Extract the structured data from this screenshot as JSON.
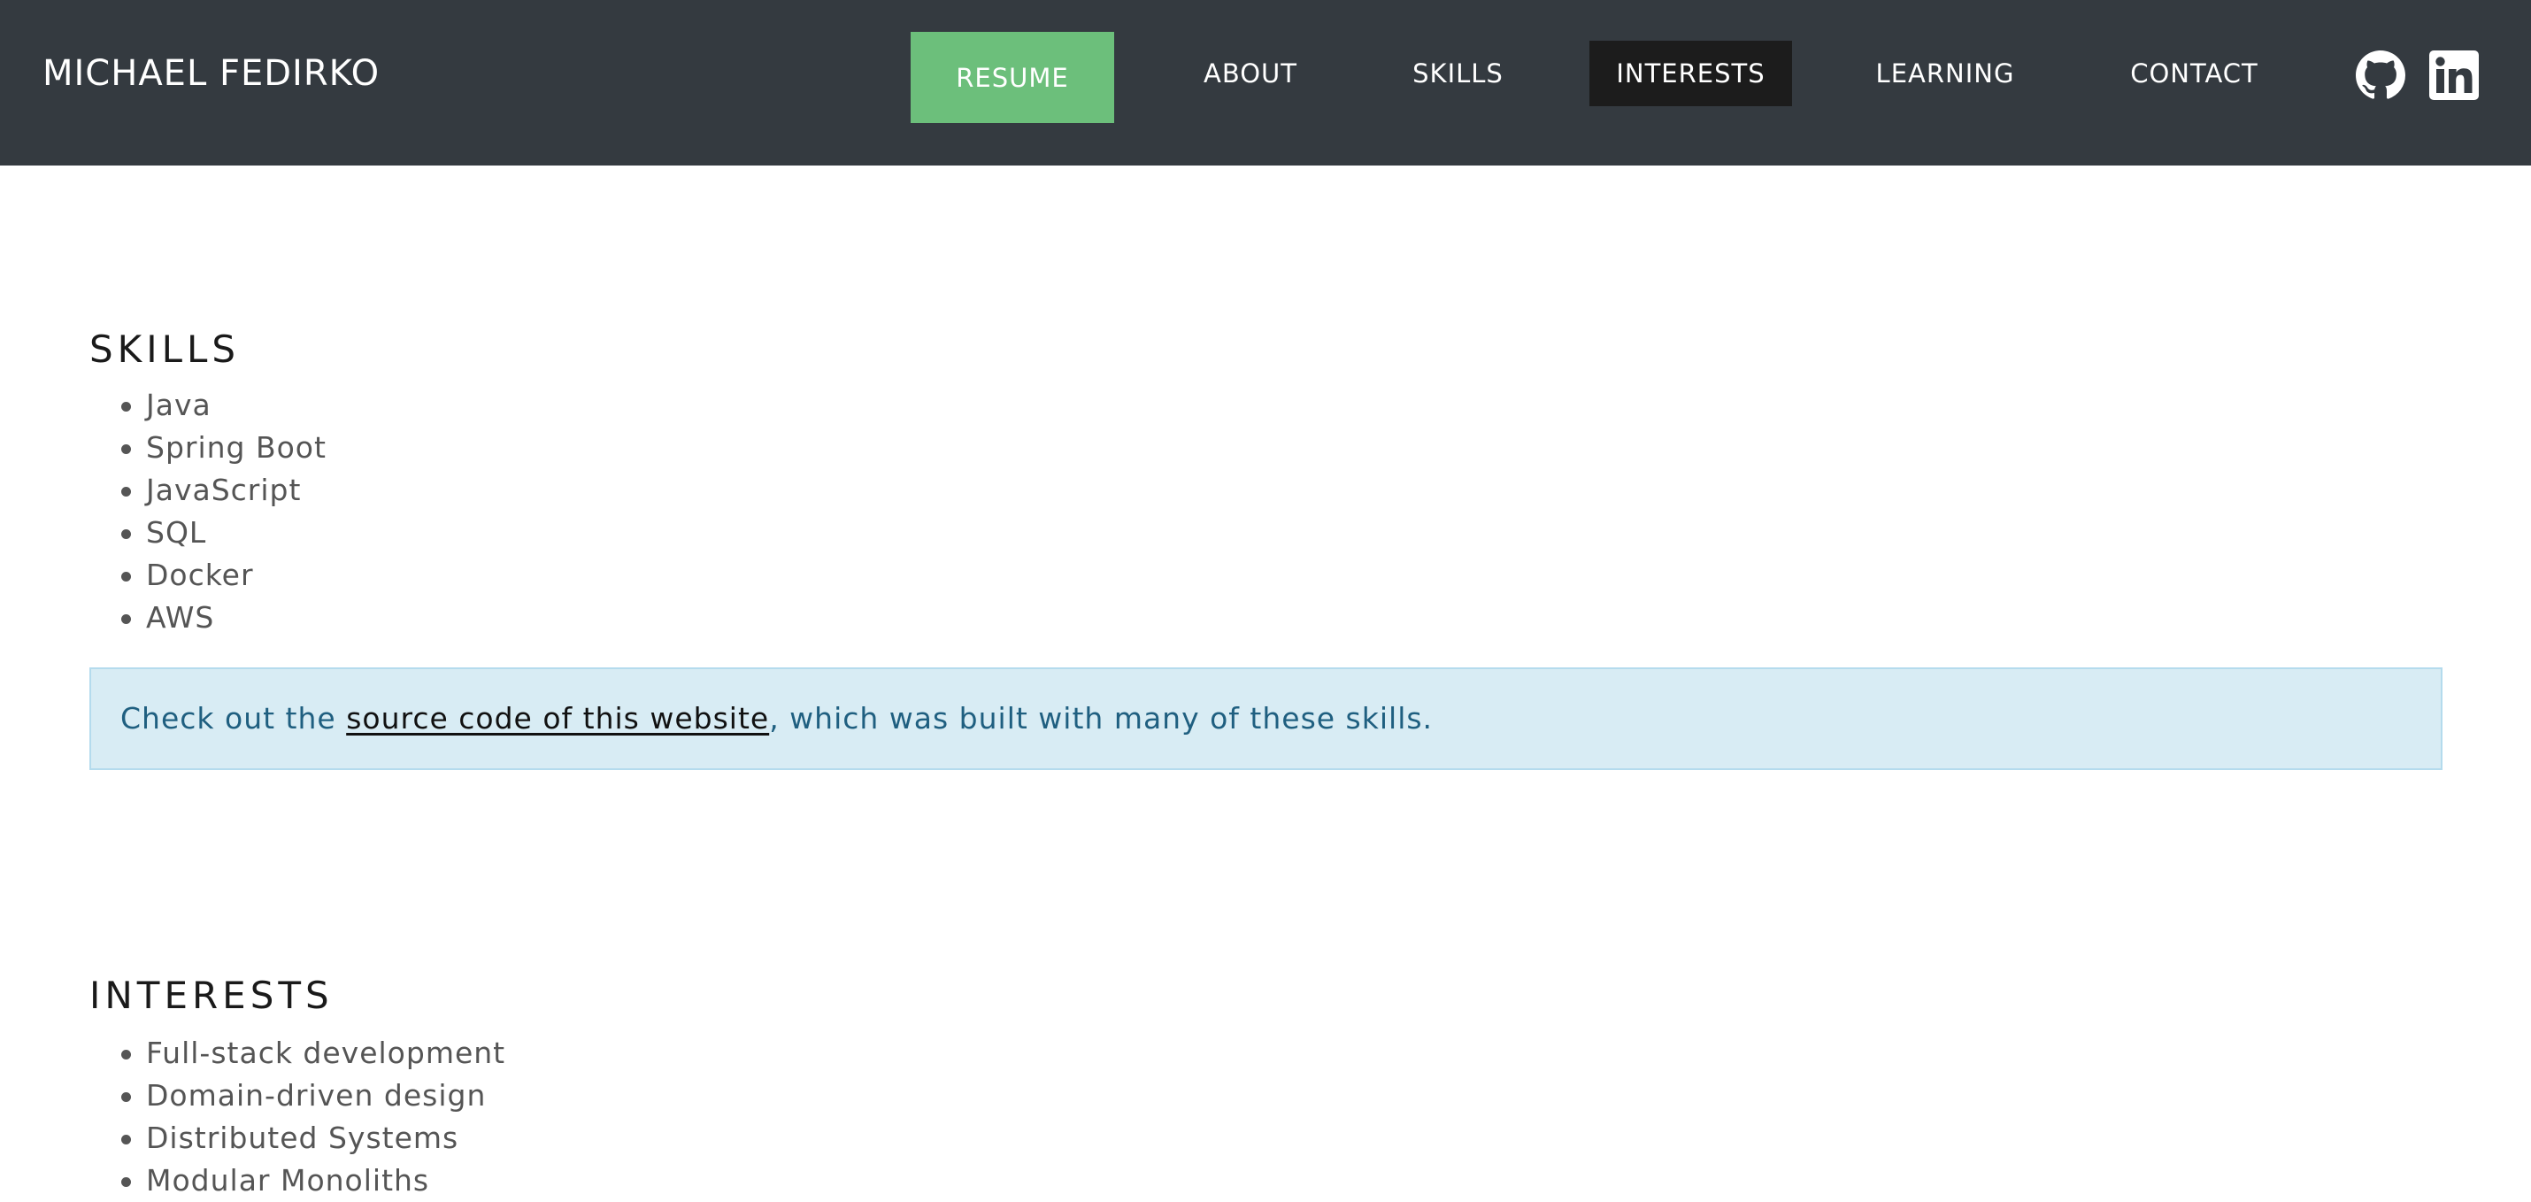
{
  "navbar": {
    "brand": "MICHAEL FEDIRKO",
    "resume_label": "RESUME",
    "items": [
      {
        "label": "ABOUT"
      },
      {
        "label": "SKILLS"
      },
      {
        "label": "INTERESTS"
      },
      {
        "label": "LEARNING"
      },
      {
        "label": "CONTACT"
      }
    ],
    "active_item": "INTERESTS",
    "social_icons": [
      "github-icon",
      "linkedin-icon"
    ]
  },
  "skills": {
    "title": "SKILLS",
    "items": [
      "Java",
      "Spring Boot",
      "JavaScript",
      "SQL",
      "Docker",
      "AWS"
    ],
    "callout": {
      "prefix": "Check out the ",
      "link_text": "source code of this website",
      "suffix": ", which was built with many of these skills."
    }
  },
  "interests": {
    "title": "INTERESTS",
    "items": [
      "Full-stack development",
      "Domain-driven design",
      "Distributed Systems",
      "Modular Monoliths"
    ]
  },
  "colors": {
    "navbar_bg": "#343a40",
    "resume_bg": "#6cbf7b",
    "active_nav_bg": "#1c1c1c",
    "callout_bg": "#d8ecf4",
    "callout_text": "#1f5f80"
  }
}
